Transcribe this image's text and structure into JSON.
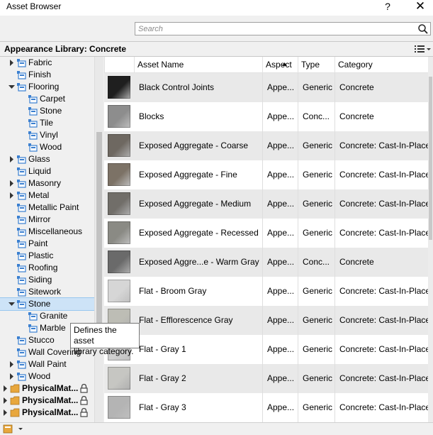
{
  "window": {
    "title": "Asset Browser",
    "help_label": "?",
    "close_label": "✕"
  },
  "search": {
    "placeholder": "Search",
    "value": ""
  },
  "library": {
    "title": "Appearance Library: Concrete"
  },
  "tree": [
    {
      "label": "Fabric",
      "level": 1,
      "twisty": "collapsed",
      "icon": "category-icon"
    },
    {
      "label": "Finish",
      "level": 1,
      "twisty": "none",
      "icon": "category-icon"
    },
    {
      "label": "Flooring",
      "level": 1,
      "twisty": "expanded",
      "icon": "category-icon"
    },
    {
      "label": "Carpet",
      "level": 2,
      "twisty": "none",
      "icon": "category-icon"
    },
    {
      "label": "Stone",
      "level": 2,
      "twisty": "none",
      "icon": "category-icon"
    },
    {
      "label": "Tile",
      "level": 2,
      "twisty": "none",
      "icon": "category-icon"
    },
    {
      "label": "Vinyl",
      "level": 2,
      "twisty": "none",
      "icon": "category-icon"
    },
    {
      "label": "Wood",
      "level": 2,
      "twisty": "none",
      "icon": "category-icon"
    },
    {
      "label": "Glass",
      "level": 1,
      "twisty": "collapsed",
      "icon": "category-icon"
    },
    {
      "label": "Liquid",
      "level": 1,
      "twisty": "none",
      "icon": "category-icon"
    },
    {
      "label": "Masonry",
      "level": 1,
      "twisty": "collapsed",
      "icon": "category-icon"
    },
    {
      "label": "Metal",
      "level": 1,
      "twisty": "collapsed",
      "icon": "category-icon"
    },
    {
      "label": "Metallic Paint",
      "level": 1,
      "twisty": "none",
      "icon": "category-icon"
    },
    {
      "label": "Mirror",
      "level": 1,
      "twisty": "none",
      "icon": "category-icon"
    },
    {
      "label": "Miscellaneous",
      "level": 1,
      "twisty": "none",
      "icon": "category-icon"
    },
    {
      "label": "Paint",
      "level": 1,
      "twisty": "none",
      "icon": "category-icon"
    },
    {
      "label": "Plastic",
      "level": 1,
      "twisty": "none",
      "icon": "category-icon"
    },
    {
      "label": "Roofing",
      "level": 1,
      "twisty": "none",
      "icon": "category-icon"
    },
    {
      "label": "Siding",
      "level": 1,
      "twisty": "none",
      "icon": "category-icon"
    },
    {
      "label": "Sitework",
      "level": 1,
      "twisty": "none",
      "icon": "category-icon"
    },
    {
      "label": "Stone",
      "level": 1,
      "twisty": "expanded",
      "icon": "category-icon",
      "selected": true
    },
    {
      "label": "Granite",
      "level": 2,
      "twisty": "none",
      "icon": "category-icon"
    },
    {
      "label": "Marble",
      "level": 2,
      "twisty": "none",
      "icon": "category-icon"
    },
    {
      "label": "Stucco",
      "level": 1,
      "twisty": "none",
      "icon": "category-icon"
    },
    {
      "label": "Wall Covering",
      "level": 1,
      "twisty": "none",
      "icon": "category-icon"
    },
    {
      "label": "Wall Paint",
      "level": 1,
      "twisty": "collapsed",
      "icon": "category-icon"
    },
    {
      "label": "Wood",
      "level": 1,
      "twisty": "collapsed",
      "icon": "category-icon"
    },
    {
      "label": "PhysicalMat...",
      "level": 0,
      "twisty": "collapsed",
      "icon": "folder-icon",
      "locked": true,
      "bold": true
    },
    {
      "label": "PhysicalMat...",
      "level": 0,
      "twisty": "collapsed",
      "icon": "folder-icon",
      "locked": true,
      "bold": true
    },
    {
      "label": "PhysicalMat...",
      "level": 0,
      "twisty": "collapsed",
      "icon": "folder-icon",
      "locked": true,
      "bold": true
    }
  ],
  "columns": {
    "name": "Asset Name",
    "aspect": "Aspect",
    "type": "Type",
    "category": "Category"
  },
  "assets": [
    {
      "name": "Black Control Joints",
      "aspect": "Appe...",
      "type": "Generic",
      "category": "Concrete",
      "swatch": "#1f1f1f"
    },
    {
      "name": "Blocks",
      "aspect": "Appe...",
      "type": "Conc...",
      "category": "Concrete",
      "swatch": "#8d8d8d"
    },
    {
      "name": "Exposed Aggregate - Coarse",
      "aspect": "Appe...",
      "type": "Generic",
      "category": "Concrete: Cast-In-Place",
      "swatch": "#6e6861"
    },
    {
      "name": "Exposed Aggregate - Fine",
      "aspect": "Appe...",
      "type": "Generic",
      "category": "Concrete: Cast-In-Place",
      "swatch": "#7c7266"
    },
    {
      "name": "Exposed Aggregate - Medium",
      "aspect": "Appe...",
      "type": "Generic",
      "category": "Concrete: Cast-In-Place",
      "swatch": "#716e69"
    },
    {
      "name": "Exposed Aggregate - Recessed",
      "aspect": "Appe...",
      "type": "Generic",
      "category": "Concrete: Cast-In-Place",
      "swatch": "#8a8a84"
    },
    {
      "name": "Exposed Aggre...e - Warm Gray",
      "aspect": "Appe...",
      "type": "Conc...",
      "category": "Concrete",
      "swatch": "#6a6a6a"
    },
    {
      "name": "Flat - Broom Gray",
      "aspect": "Appe...",
      "type": "Generic",
      "category": "Concrete: Cast-In-Place",
      "swatch": "#d6d6d6"
    },
    {
      "name": "Flat - Efflorescence Gray",
      "aspect": "Appe...",
      "type": "Generic",
      "category": "Concrete: Cast-In-Place",
      "swatch": "#bdbdb5"
    },
    {
      "name": "Flat - Gray 1",
      "aspect": "Appe...",
      "type": "Generic",
      "category": "Concrete: Cast-In-Place",
      "swatch": "#cfcfcf"
    },
    {
      "name": "Flat - Gray 2",
      "aspect": "Appe...",
      "type": "Generic",
      "category": "Concrete: Cast-In-Place",
      "swatch": "#c6c6c2"
    },
    {
      "name": "Flat - Gray 3",
      "aspect": "Appe...",
      "type": "Generic",
      "category": "Concrete: Cast-In-Place",
      "swatch": "#b4b4b4"
    }
  ],
  "tooltip": {
    "line1": "Defines the asset",
    "line2": "library category."
  },
  "colors": {
    "selection": "#cde3f7",
    "category_icon": "#3a7fd0",
    "folder_icon": "#e8a73d",
    "lock": "#444444"
  }
}
